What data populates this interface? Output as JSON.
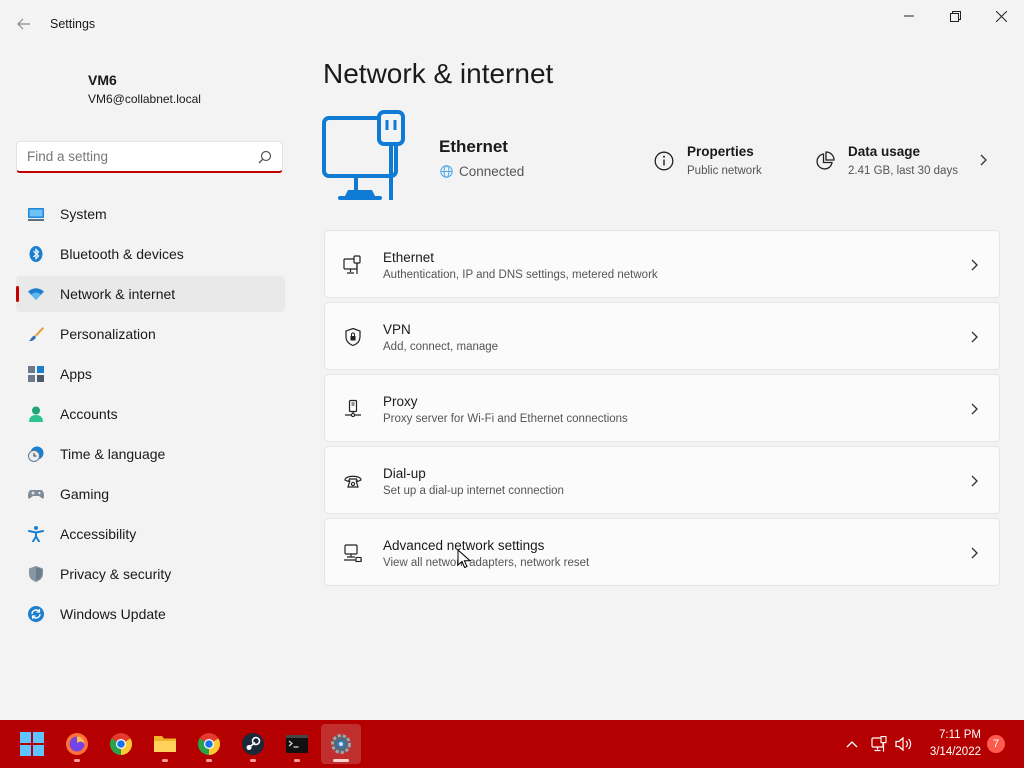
{
  "window": {
    "title": "Settings"
  },
  "user": {
    "name": "VM6",
    "email": "VM6@collabnet.local"
  },
  "search": {
    "placeholder": "Find a setting"
  },
  "sidebar": {
    "items": [
      {
        "label": "System",
        "icon": "system-icon"
      },
      {
        "label": "Bluetooth & devices",
        "icon": "bluetooth-icon"
      },
      {
        "label": "Network & internet",
        "icon": "wifi-icon",
        "active": true
      },
      {
        "label": "Personalization",
        "icon": "brush-icon"
      },
      {
        "label": "Apps",
        "icon": "apps-icon"
      },
      {
        "label": "Accounts",
        "icon": "accounts-icon"
      },
      {
        "label": "Time & language",
        "icon": "clock-globe-icon"
      },
      {
        "label": "Gaming",
        "icon": "gamepad-icon"
      },
      {
        "label": "Accessibility",
        "icon": "accessibility-icon"
      },
      {
        "label": "Privacy & security",
        "icon": "shield-icon"
      },
      {
        "label": "Windows Update",
        "icon": "update-icon"
      }
    ]
  },
  "main": {
    "title": "Network & internet",
    "connection": {
      "name": "Ethernet",
      "status": "Connected",
      "properties_title": "Properties",
      "properties_sub": "Public network",
      "usage_title": "Data usage",
      "usage_sub": "2.41 GB, last 30 days"
    },
    "cards": [
      {
        "title": "Ethernet",
        "subtitle": "Authentication, IP and DNS settings, metered network",
        "icon": "ethernet-icon"
      },
      {
        "title": "VPN",
        "subtitle": "Add, connect, manage",
        "icon": "vpn-shield-icon"
      },
      {
        "title": "Proxy",
        "subtitle": "Proxy server for Wi-Fi and Ethernet connections",
        "icon": "proxy-icon"
      },
      {
        "title": "Dial-up",
        "subtitle": "Set up a dial-up internet connection",
        "icon": "dialup-icon"
      },
      {
        "title": "Advanced network settings",
        "subtitle": "View all network adapters, network reset",
        "icon": "advanced-network-icon"
      }
    ]
  },
  "taskbar": {
    "apps": [
      "start",
      "firefox",
      "chrome",
      "file-explorer",
      "chrome",
      "steam",
      "terminal",
      "settings"
    ],
    "clock_time": "7:11 PM",
    "clock_date": "3/14/2022",
    "notification_count": "7"
  },
  "colors": {
    "accent": "#c40000",
    "taskbar": "#b40000",
    "icon_blue": "#0f7bd4"
  }
}
